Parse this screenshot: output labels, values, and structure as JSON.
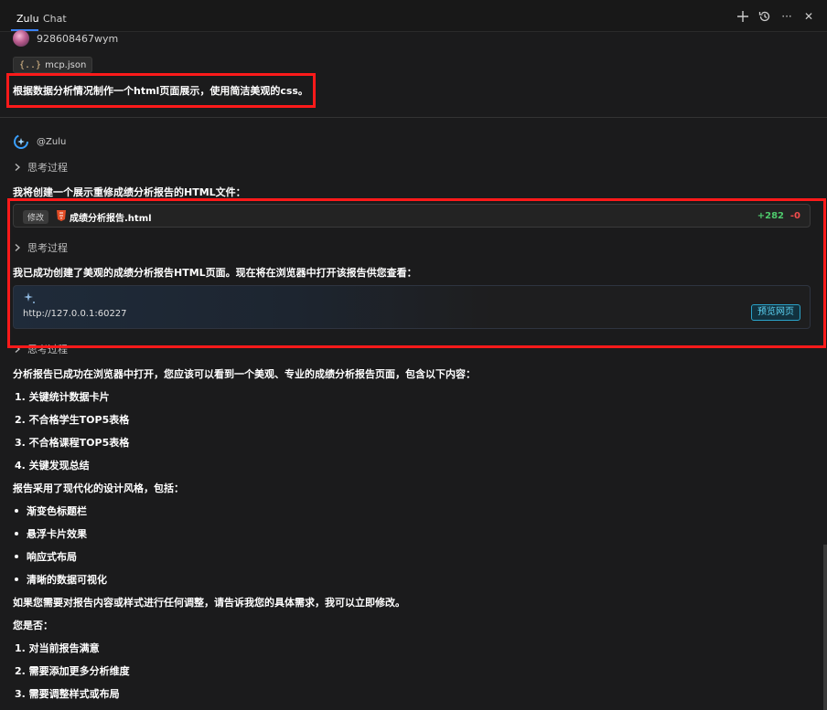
{
  "tabs": [
    {
      "label": "Zulu",
      "active": true
    },
    {
      "label": "Chat",
      "active": false
    }
  ],
  "toolbar": {
    "icons": [
      "plus-icon",
      "history-icon",
      "more-icon",
      "close-icon"
    ],
    "more_label": "···",
    "close_label": "✕"
  },
  "user": {
    "name": "928608467wym",
    "attachment": {
      "icon": "json-file-icon",
      "icon_glyph": "{..}",
      "name": "mcp.json"
    },
    "message": "根据数据分析情况制作一个html页面展示，使用简洁美观的css。"
  },
  "assistant": {
    "name": "@Zulu",
    "thinking_label": "思考过程",
    "intro": "我将创建一个展示重修成绩分析报告的HTML文件：",
    "file_change": {
      "badge": "修改",
      "file": "成绩分析报告.html",
      "added": "+282",
      "removed": "-0"
    },
    "success_text": "我已成功创建了美观的成绩分析报告HTML页面。现在将在浏览器中打开该报告供您查看：",
    "preview": {
      "url": "http://127.0.0.1:60227",
      "button": "预览网页"
    },
    "summary": "分析报告已成功在浏览器中打开，您应该可以看到一个美观、专业的成绩分析报告页面，包含以下内容：",
    "contents": [
      "1. 关键统计数据卡片",
      "2. 不合格学生TOP5表格",
      "3. 不合格课程TOP5表格",
      "4. 关键发现总结"
    ],
    "style_intro": "报告采用了现代化的设计风格，包括：",
    "styles": [
      "渐变色标题栏",
      "悬浮卡片效果",
      "响应式布局",
      "清晰的数据可视化"
    ],
    "adjust_text": "如果您需要对报告内容或样式进行任何调整，请告诉我您的具体需求，我可以立即修改。",
    "question": "您是否：",
    "options": [
      "1. 对当前报告满意",
      "2. 需要添加更多分析维度",
      "3. 需要调整样式或布局"
    ]
  },
  "colors": {
    "background": "#1b1b1c",
    "highlight_box": "#ff1a1a",
    "diff_added": "#4ec96c",
    "diff_removed": "#f14c4c",
    "preview_button": "#5cd3f3",
    "active_tab_underline": "#3b82f6"
  }
}
